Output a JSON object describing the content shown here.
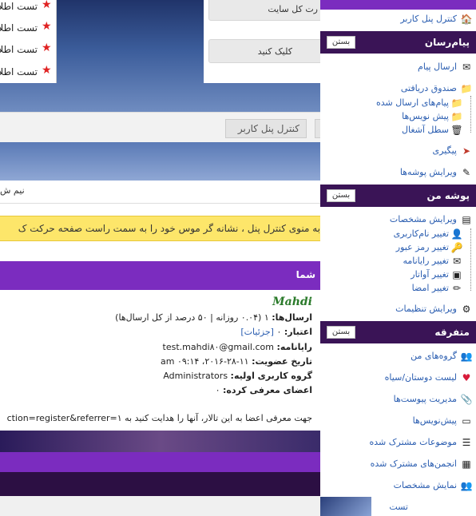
{
  "top_list": {
    "items": [
      "تست اطلا",
      "تست اطلا",
      "تست اطلا",
      "تست اطلا"
    ]
  },
  "cp_box": {
    "site_all": "رت کل سایت",
    "click": "کلیک کنید"
  },
  "breadcrumb": {
    "cp_label": "کنترل پنل کاربر"
  },
  "half_text": "نیم ش",
  "yellow_tip": "به منوی کنترل پنل ، نشانه گر موس خود را به سمت راست صفحه حرکت ک",
  "purple_header": "شما",
  "profile": {
    "name": "Mahdi",
    "posts_label": "ارسال‌ها:",
    "posts_value": "۱ (۰.۰۴ روزانه | ۵۰ درصد از کل ارسال‌ها)",
    "credit_label": "اعتبار:",
    "credit_value": "۰",
    "credit_link": "[جزئیات]",
    "email_label": "رایانامه:",
    "email_value": "test.mahdi۸۰@gmail.com",
    "join_label": "تاریخ عضویت:",
    "join_value": "۱۱-۲۸-۲۰۱۶، ۰۹:۱۴ am",
    "group_label": "گروه کاربری اولیه:",
    "group_value": "Administrators",
    "ref_label": "اعضای معرفی کرده:",
    "ref_value": "۰",
    "ref_note": "جهت معرفی اعضا به این تالار، آنها را هدایت کنید به ۱=ction=register&referrer"
  },
  "sidebar": {
    "cp_link": "کنترل پنل کاربر",
    "close_label": "بستن",
    "messages": {
      "title": "پیام‌رسان",
      "items": [
        "ارسال پیام",
        "صندوق دریافتی",
        "پیام‌های ارسال شده",
        "پیش نویس‌ها",
        "سطل آشغال",
        "پیگیری",
        "ویرایش پوشه‌ها"
      ]
    },
    "mypage": {
      "title": "پوشه من",
      "items": [
        "ویرایش مشخصات",
        "تغییر نام‌کاربری",
        "تغییر رمز عبور",
        "تغییر رایانامه",
        "تغییر آواتار",
        "تغییر امضا",
        "ویرایش تنظیمات"
      ]
    },
    "misc": {
      "title": "متفرقه",
      "items": [
        "گروه‌های من",
        "لیست دوستان/سیاه",
        "مدیریت پیوست‌ها",
        "پیش‌نویس‌ها",
        "موضوعات مشترک شده",
        "انجمن‌های مشترک شده",
        "نمایش مشخصات"
      ]
    },
    "bottom_item": "تست"
  },
  "colors": {
    "purple": "#7b2cbf",
    "dark_purple": "#3a1456",
    "link_blue": "#2a5db0",
    "tip_yellow": "#fde66a"
  }
}
